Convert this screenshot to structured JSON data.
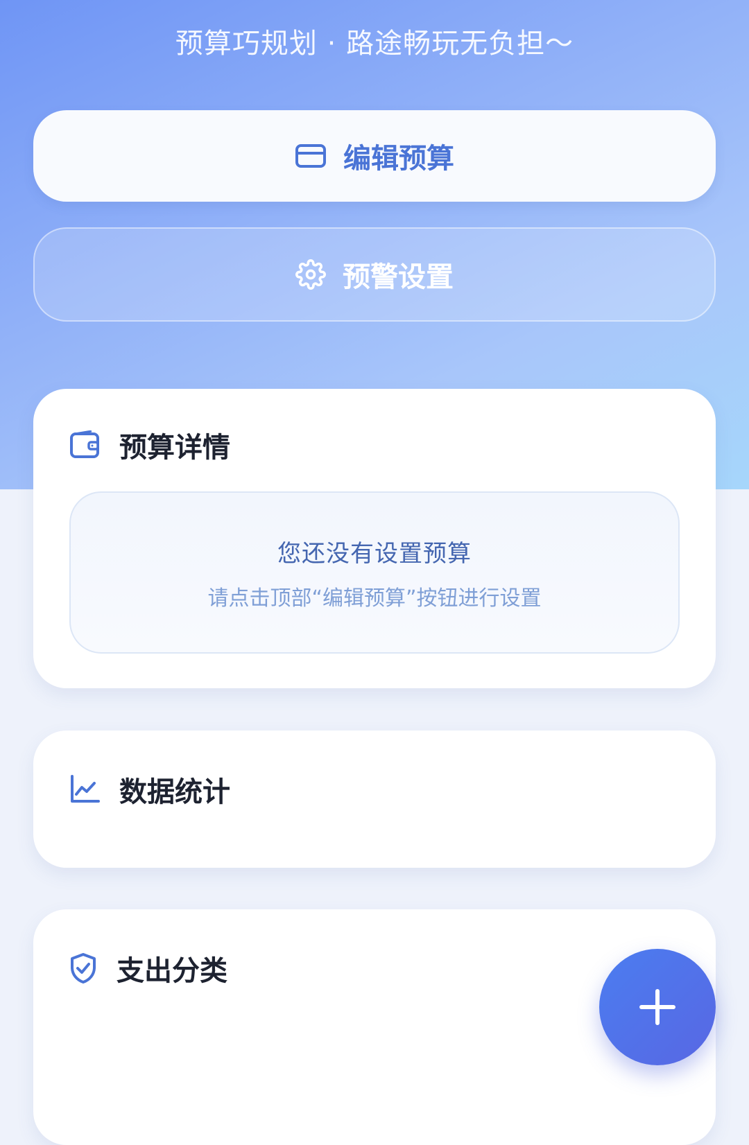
{
  "header": {
    "subtitle": "预算巧规划 · 路途畅玩无负担～"
  },
  "actions": {
    "edit_budget": {
      "label": "编辑预算",
      "icon": "card-icon"
    },
    "alert_settings": {
      "label": "预警设置",
      "icon": "gear-icon"
    }
  },
  "budget_details": {
    "title": "预算详情",
    "icon": "wallet-icon",
    "empty_title": "您还没有设置预算",
    "empty_desc": "请点击顶部“编辑预算”按钮进行设置"
  },
  "statistics": {
    "title": "数据统计",
    "icon": "line-chart-icon"
  },
  "categories": {
    "title": "支出分类",
    "icon": "shield-check-icon"
  },
  "fab": {
    "icon": "plus-icon"
  },
  "colors": {
    "accent": "#4a74d6",
    "fab_start": "#4b7df0",
    "fab_end": "#5867e3"
  }
}
